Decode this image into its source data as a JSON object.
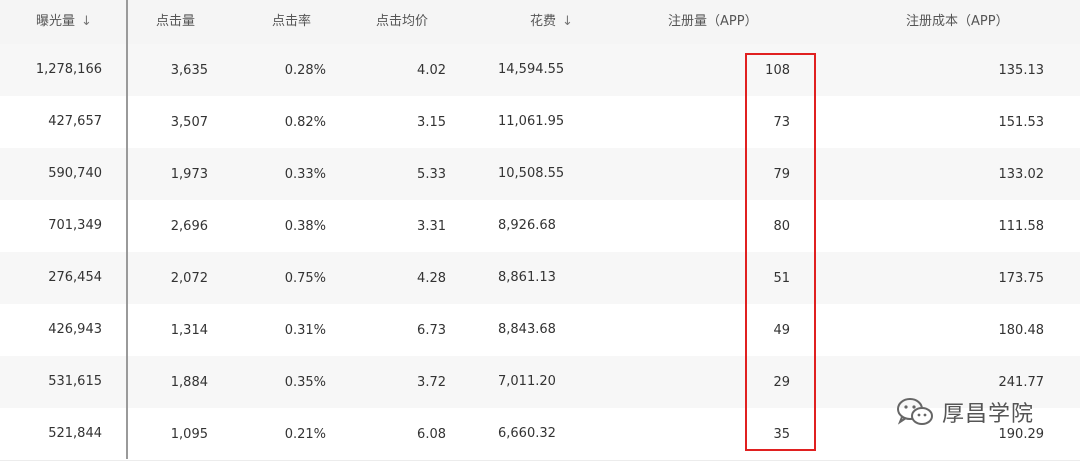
{
  "colors": {
    "highlight": "#e02020",
    "header_bg": "#f5f5f5",
    "alt_row_bg": "#f7f7f7"
  },
  "columns": [
    {
      "key": "impressions",
      "label": "曝光量",
      "sort_icon": "↓"
    },
    {
      "key": "clicks",
      "label": "点击量"
    },
    {
      "key": "ctr",
      "label": "点击率"
    },
    {
      "key": "cpc",
      "label": "点击均价"
    },
    {
      "key": "spend",
      "label": "花费",
      "sort_icon": "↓"
    },
    {
      "key": "registrations",
      "label": "注册量（APP）"
    },
    {
      "key": "reg_cost",
      "label": "注册成本（APP）"
    }
  ],
  "rows": [
    {
      "impressions": "1,278,166",
      "clicks": "3,635",
      "ctr": "0.28%",
      "cpc": "4.02",
      "spend": "14,594.55",
      "registrations": "108",
      "reg_cost": "135.13"
    },
    {
      "impressions": "427,657",
      "clicks": "3,507",
      "ctr": "0.82%",
      "cpc": "3.15",
      "spend": "11,061.95",
      "registrations": "73",
      "reg_cost": "151.53"
    },
    {
      "impressions": "590,740",
      "clicks": "1,973",
      "ctr": "0.33%",
      "cpc": "5.33",
      "spend": "10,508.55",
      "registrations": "79",
      "reg_cost": "133.02"
    },
    {
      "impressions": "701,349",
      "clicks": "2,696",
      "ctr": "0.38%",
      "cpc": "3.31",
      "spend": "8,926.68",
      "registrations": "80",
      "reg_cost": "111.58"
    },
    {
      "impressions": "276,454",
      "clicks": "2,072",
      "ctr": "0.75%",
      "cpc": "4.28",
      "spend": "8,861.13",
      "registrations": "51",
      "reg_cost": "173.75"
    },
    {
      "impressions": "426,943",
      "clicks": "1,314",
      "ctr": "0.31%",
      "cpc": "6.73",
      "spend": "8,843.68",
      "registrations": "49",
      "reg_cost": "180.48"
    },
    {
      "impressions": "531,615",
      "clicks": "1,884",
      "ctr": "0.35%",
      "cpc": "3.72",
      "spend": "7,011.20",
      "registrations": "29",
      "reg_cost": "241.77"
    },
    {
      "impressions": "521,844",
      "clicks": "1,095",
      "ctr": "0.21%",
      "cpc": "6.08",
      "spend": "6,660.32",
      "registrations": "35",
      "reg_cost": "190.29"
    }
  ],
  "watermark": {
    "icon": "wechat-icon",
    "text": "厚昌学院"
  }
}
